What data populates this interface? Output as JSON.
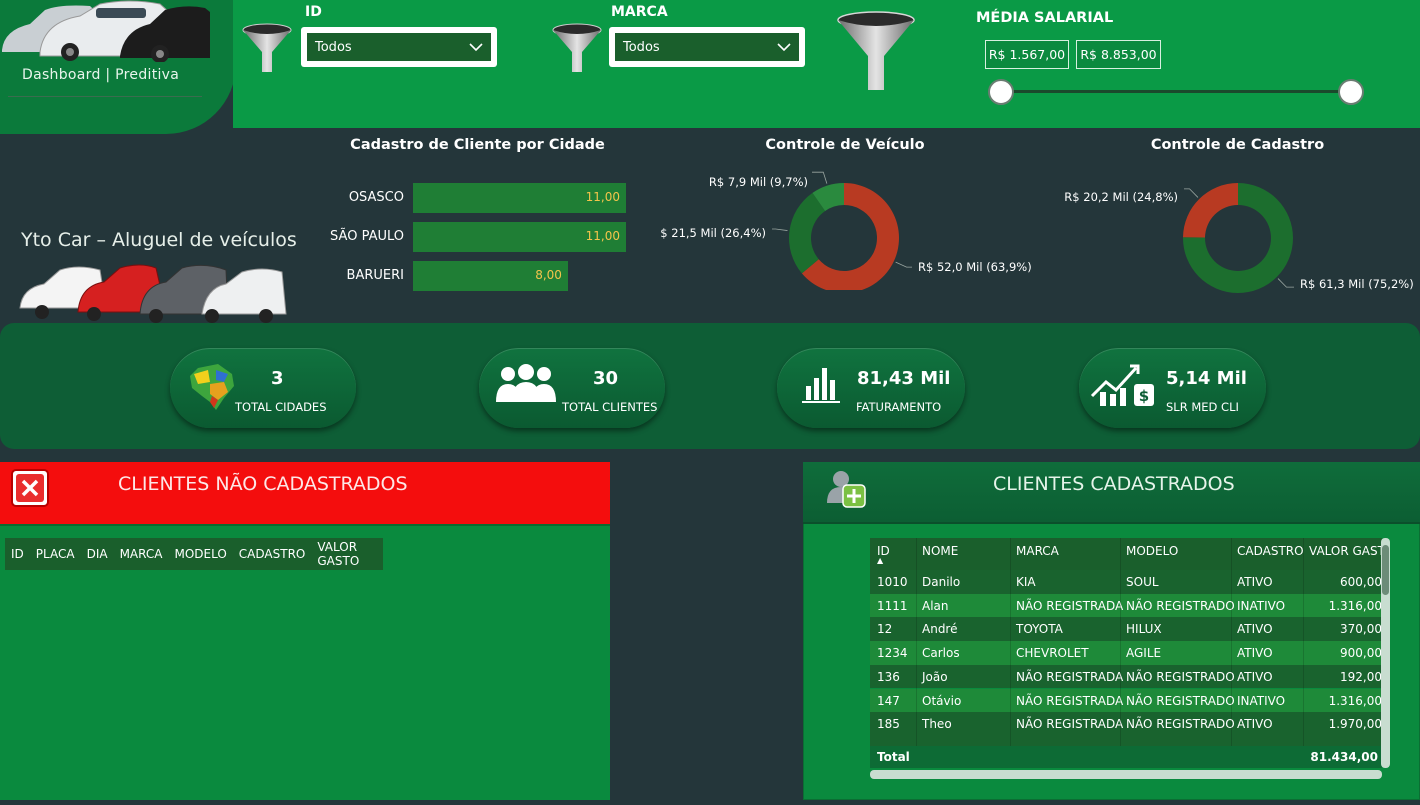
{
  "nav": {
    "label": "Dashboard | Preditiva"
  },
  "filters": {
    "id": {
      "label": "ID",
      "value": "Todos"
    },
    "marca": {
      "label": "MARCA",
      "value": "Todos"
    },
    "salary": {
      "label": "MÉDIA SALARIAL",
      "min": "R$ 1.567,00",
      "max": "R$ 8.853,00"
    }
  },
  "tagline": "Yto Car – Aluguel de veículos",
  "chart_data": [
    {
      "type": "bar",
      "title": "Cadastro de Cliente por Cidade",
      "categories": [
        "OSASCO",
        "SÃO PAULO",
        "BARUERI"
      ],
      "values": [
        11,
        11,
        8
      ],
      "value_labels": [
        "11,00",
        "11,00",
        "8,00"
      ],
      "orientation": "horizontal"
    },
    {
      "type": "pie",
      "title": "Controle de Veículo",
      "labels": [
        "R$ 52,0 Mil (63,9%)",
        "R$ 21,5 Mil (26,4%)",
        "R$ 7,9 Mil (9,7%)"
      ],
      "values": [
        52.0,
        21.5,
        7.9
      ],
      "percent": [
        63.9,
        26.4,
        9.7
      ],
      "colors": [
        "#b83a22",
        "#1c6e2e",
        "#2a8a3e"
      ],
      "donut": true
    },
    {
      "type": "pie",
      "title": "Controle de Cadastro",
      "labels": [
        "R$ 61,3 Mil (75,2%)",
        "R$ 20,2 Mil (24,8%)"
      ],
      "values": [
        61.3,
        20.2
      ],
      "percent": [
        75.2,
        24.8
      ],
      "colors": [
        "#1c6e2e",
        "#b83a22"
      ],
      "donut": true
    }
  ],
  "kpis": [
    {
      "value": "3",
      "label": "TOTAL CIDADES",
      "icon": "brazil-map-icon"
    },
    {
      "value": "30",
      "label": "TOTAL CLIENTES",
      "icon": "people-icon"
    },
    {
      "value": "81,43 Mil",
      "label": "FATURAMENTO",
      "icon": "bar-chart-icon"
    },
    {
      "value": "5,14 Mil",
      "label": "SLR MED CLI",
      "icon": "money-growth-icon"
    }
  ],
  "not_registered": {
    "title": "CLIENTES NÃO CADASTRADOS",
    "columns": [
      "ID",
      "PLACA",
      "DIA",
      "MARCA",
      "MODELO",
      "CADASTRO",
      "VALOR GASTO"
    ]
  },
  "registered": {
    "title": "CLIENTES CADASTRADOS",
    "columns": [
      "ID",
      "NOME",
      "MARCA",
      "MODELO",
      "CADASTRO",
      "VALOR GASTO"
    ],
    "rows": [
      [
        "1010",
        "Danilo",
        "KIA",
        "SOUL",
        "ATIVO",
        "600,00"
      ],
      [
        "1111",
        "Alan",
        "NÃO REGISTRADA",
        "NÃO REGISTRADO",
        "INATIVO",
        "1.316,00"
      ],
      [
        "12",
        "André",
        "TOYOTA",
        "HILUX",
        "ATIVO",
        "370,00"
      ],
      [
        "1234",
        "Carlos",
        "CHEVROLET",
        "AGILE",
        "ATIVO",
        "900,00"
      ],
      [
        "136",
        "João",
        "NÃO REGISTRADA",
        "NÃO REGISTRADO",
        "ATIVO",
        "192,00"
      ],
      [
        "147",
        "Otávio",
        "NÃO REGISTRADA",
        "NÃO REGISTRADO",
        "INATIVO",
        "1.316,00"
      ],
      [
        "185",
        "Theo",
        "NÃO REGISTRADA",
        "NÃO REGISTRADO",
        "ATIVO",
        "1.970,00"
      ]
    ],
    "total_label": "Total",
    "total_value": "81.434,00"
  },
  "colors": {
    "accent": "#0a9a46",
    "dark_bg": "#24363a",
    "alert": "#f40d0d"
  }
}
